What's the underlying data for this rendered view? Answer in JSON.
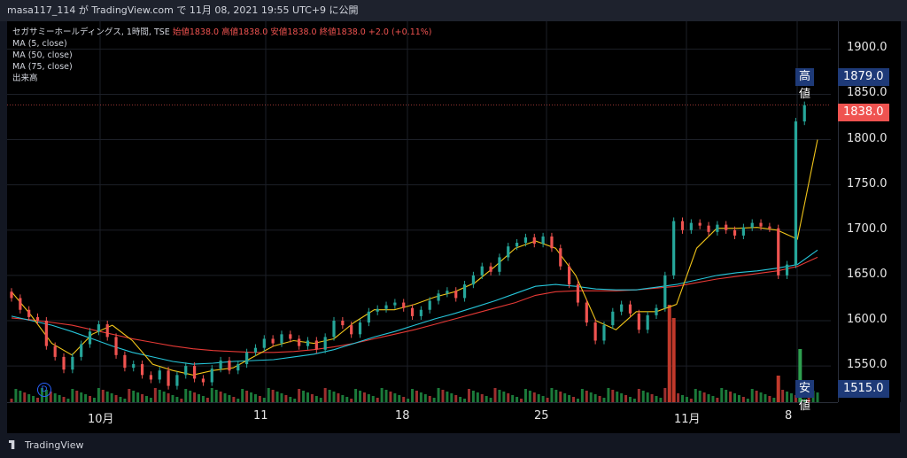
{
  "topbar": {
    "caption": "masa117_114 が TradingView.com で 11月 08, 2021 19:55 UTC+9 に公開"
  },
  "legend": {
    "symbol": "セガサミーホールディングス, 1時間, TSE",
    "ohlc": "始値1838.0 高値1838.0 安値1838.0 終値1838.0 +2.0 (+0.11%)",
    "ma5": "MA (5, close)",
    "ma50": "MA (50, close)",
    "ma75": "MA (75, close)",
    "volume": "出来高"
  },
  "badges": {
    "high_key": "高値",
    "high_val": "1879.0",
    "last_val": "1838.0",
    "low_key": "安値",
    "low_val": "1515.0"
  },
  "marker": {
    "label": "D"
  },
  "footer": {
    "brand": "TradingView"
  },
  "colors": {
    "up": "#26a69a",
    "down": "#ef5350",
    "ma5": "#f0c419",
    "ma50": "#26c6da",
    "ma75": "#e53935",
    "last": "#ef5350"
  },
  "chart_data": {
    "type": "candlestick",
    "y_ticks": [
      "1900.0",
      "1850.0",
      "1800.0",
      "1750.0",
      "1700.0",
      "1650.0",
      "1600.0",
      "1550.0"
    ],
    "x_ticks": [
      "10月",
      "11",
      "18",
      "25",
      "11月",
      "8"
    ],
    "ylim": [
      1515,
      1910
    ],
    "candles": [
      {
        "i": 0,
        "o": 1632,
        "c": 1625
      },
      {
        "i": 2,
        "o": 1625,
        "c": 1612
      },
      {
        "i": 4,
        "o": 1612,
        "c": 1604
      },
      {
        "i": 6,
        "o": 1604,
        "c": 1600
      },
      {
        "i": 8,
        "o": 1600,
        "c": 1572
      },
      {
        "i": 10,
        "o": 1572,
        "c": 1560
      },
      {
        "i": 12,
        "o": 1560,
        "c": 1546
      },
      {
        "i": 14,
        "o": 1546,
        "c": 1560
      },
      {
        "i": 16,
        "o": 1560,
        "c": 1574
      },
      {
        "i": 18,
        "o": 1574,
        "c": 1588
      },
      {
        "i": 20,
        "o": 1588,
        "c": 1596
      },
      {
        "i": 22,
        "o": 1596,
        "c": 1582
      },
      {
        "i": 24,
        "o": 1582,
        "c": 1562
      },
      {
        "i": 26,
        "o": 1562,
        "c": 1548
      },
      {
        "i": 28,
        "o": 1548,
        "c": 1552
      },
      {
        "i": 30,
        "o": 1552,
        "c": 1540
      },
      {
        "i": 32,
        "o": 1540,
        "c": 1535
      },
      {
        "i": 34,
        "o": 1535,
        "c": 1545
      },
      {
        "i": 36,
        "o": 1545,
        "c": 1528
      },
      {
        "i": 38,
        "o": 1528,
        "c": 1540
      },
      {
        "i": 40,
        "o": 1540,
        "c": 1550
      },
      {
        "i": 42,
        "o": 1550,
        "c": 1536
      },
      {
        "i": 44,
        "o": 1536,
        "c": 1532
      },
      {
        "i": 46,
        "o": 1532,
        "c": 1547
      },
      {
        "i": 48,
        "o": 1547,
        "c": 1556
      },
      {
        "i": 50,
        "o": 1556,
        "c": 1545
      },
      {
        "i": 52,
        "o": 1545,
        "c": 1552
      },
      {
        "i": 54,
        "o": 1552,
        "c": 1565
      },
      {
        "i": 56,
        "o": 1565,
        "c": 1570
      },
      {
        "i": 58,
        "o": 1570,
        "c": 1580
      },
      {
        "i": 60,
        "o": 1580,
        "c": 1575
      },
      {
        "i": 62,
        "o": 1575,
        "c": 1585
      },
      {
        "i": 64,
        "o": 1585,
        "c": 1580
      },
      {
        "i": 66,
        "o": 1580,
        "c": 1572
      },
      {
        "i": 68,
        "o": 1572,
        "c": 1578
      },
      {
        "i": 70,
        "o": 1578,
        "c": 1568
      },
      {
        "i": 72,
        "o": 1568,
        "c": 1582
      },
      {
        "i": 74,
        "o": 1582,
        "c": 1600
      },
      {
        "i": 76,
        "o": 1600,
        "c": 1595
      },
      {
        "i": 78,
        "o": 1595,
        "c": 1585
      },
      {
        "i": 80,
        "o": 1585,
        "c": 1598
      },
      {
        "i": 82,
        "o": 1598,
        "c": 1610
      },
      {
        "i": 84,
        "o": 1610,
        "c": 1613
      },
      {
        "i": 86,
        "o": 1613,
        "c": 1617
      },
      {
        "i": 88,
        "o": 1617,
        "c": 1620
      },
      {
        "i": 90,
        "o": 1620,
        "c": 1614
      },
      {
        "i": 92,
        "o": 1614,
        "c": 1605
      },
      {
        "i": 94,
        "o": 1605,
        "c": 1612
      },
      {
        "i": 96,
        "o": 1612,
        "c": 1622
      },
      {
        "i": 98,
        "o": 1622,
        "c": 1630
      },
      {
        "i": 100,
        "o": 1630,
        "c": 1633
      },
      {
        "i": 102,
        "o": 1633,
        "c": 1625
      },
      {
        "i": 104,
        "o": 1625,
        "c": 1640
      },
      {
        "i": 106,
        "o": 1640,
        "c": 1650
      },
      {
        "i": 108,
        "o": 1650,
        "c": 1660
      },
      {
        "i": 110,
        "o": 1660,
        "c": 1654
      },
      {
        "i": 112,
        "o": 1654,
        "c": 1670
      },
      {
        "i": 114,
        "o": 1670,
        "c": 1682
      },
      {
        "i": 116,
        "o": 1682,
        "c": 1686
      },
      {
        "i": 118,
        "o": 1686,
        "c": 1692
      },
      {
        "i": 120,
        "o": 1692,
        "c": 1685
      },
      {
        "i": 122,
        "o": 1685,
        "c": 1693
      },
      {
        "i": 124,
        "o": 1693,
        "c": 1680
      },
      {
        "i": 126,
        "o": 1680,
        "c": 1660
      },
      {
        "i": 128,
        "o": 1660,
        "c": 1640
      },
      {
        "i": 130,
        "o": 1640,
        "c": 1620
      },
      {
        "i": 132,
        "o": 1620,
        "c": 1598
      },
      {
        "i": 134,
        "o": 1598,
        "c": 1578
      },
      {
        "i": 136,
        "o": 1578,
        "c": 1595
      },
      {
        "i": 138,
        "o": 1595,
        "c": 1610
      },
      {
        "i": 140,
        "o": 1610,
        "c": 1618
      },
      {
        "i": 142,
        "o": 1618,
        "c": 1608
      },
      {
        "i": 144,
        "o": 1608,
        "c": 1590
      },
      {
        "i": 146,
        "o": 1590,
        "c": 1606
      },
      {
        "i": 148,
        "o": 1606,
        "c": 1614
      },
      {
        "i": 150,
        "o": 1614,
        "c": 1650
      },
      {
        "i": 152,
        "o": 1650,
        "c": 1710
      },
      {
        "i": 154,
        "o": 1710,
        "c": 1700
      },
      {
        "i": 156,
        "o": 1700,
        "c": 1708
      },
      {
        "i": 158,
        "o": 1708,
        "c": 1705
      },
      {
        "i": 160,
        "o": 1705,
        "c": 1698
      },
      {
        "i": 162,
        "o": 1698,
        "c": 1706
      },
      {
        "i": 164,
        "o": 1706,
        "c": 1700
      },
      {
        "i": 166,
        "o": 1700,
        "c": 1694
      },
      {
        "i": 168,
        "o": 1694,
        "c": 1703
      },
      {
        "i": 170,
        "o": 1703,
        "c": 1708
      },
      {
        "i": 172,
        "o": 1708,
        "c": 1704
      },
      {
        "i": 174,
        "o": 1704,
        "c": 1702
      },
      {
        "i": 176,
        "o": 1702,
        "c": 1650
      },
      {
        "i": 178,
        "o": 1650,
        "c": 1662
      },
      {
        "i": 180,
        "o": 1662,
        "c": 1820
      },
      {
        "i": 182,
        "o": 1820,
        "c": 1838
      }
    ],
    "ma5": [
      1632,
      1605,
      1575,
      1562,
      1585,
      1595,
      1578,
      1552,
      1545,
      1540,
      1545,
      1548,
      1560,
      1572,
      1578,
      1575,
      1580,
      1598,
      1612,
      1612,
      1618,
      1626,
      1632,
      1642,
      1660,
      1680,
      1688,
      1680,
      1650,
      1600,
      1590,
      1610,
      1610,
      1618,
      1680,
      1702,
      1702,
      1703,
      1700,
      1690,
      1800
    ],
    "ma50": [
      1605,
      1600,
      1595,
      1588,
      1580,
      1572,
      1565,
      1560,
      1555,
      1552,
      1553,
      1555,
      1556,
      1557,
      1560,
      1563,
      1568,
      1575,
      1582,
      1588,
      1595,
      1602,
      1608,
      1615,
      1622,
      1630,
      1638,
      1640,
      1638,
      1635,
      1634,
      1634,
      1637,
      1640,
      1645,
      1650,
      1653,
      1655,
      1658,
      1662,
      1678
    ],
    "ma75": [
      1603,
      1601,
      1598,
      1595,
      1590,
      1585,
      1580,
      1576,
      1572,
      1569,
      1567,
      1566,
      1565,
      1565,
      1566,
      1568,
      1571,
      1575,
      1580,
      1585,
      1590,
      1596,
      1602,
      1608,
      1614,
      1620,
      1628,
      1632,
      1633,
      1633,
      1633,
      1634,
      1636,
      1638,
      1642,
      1646,
      1649,
      1652,
      1655,
      1660,
      1670
    ]
  }
}
